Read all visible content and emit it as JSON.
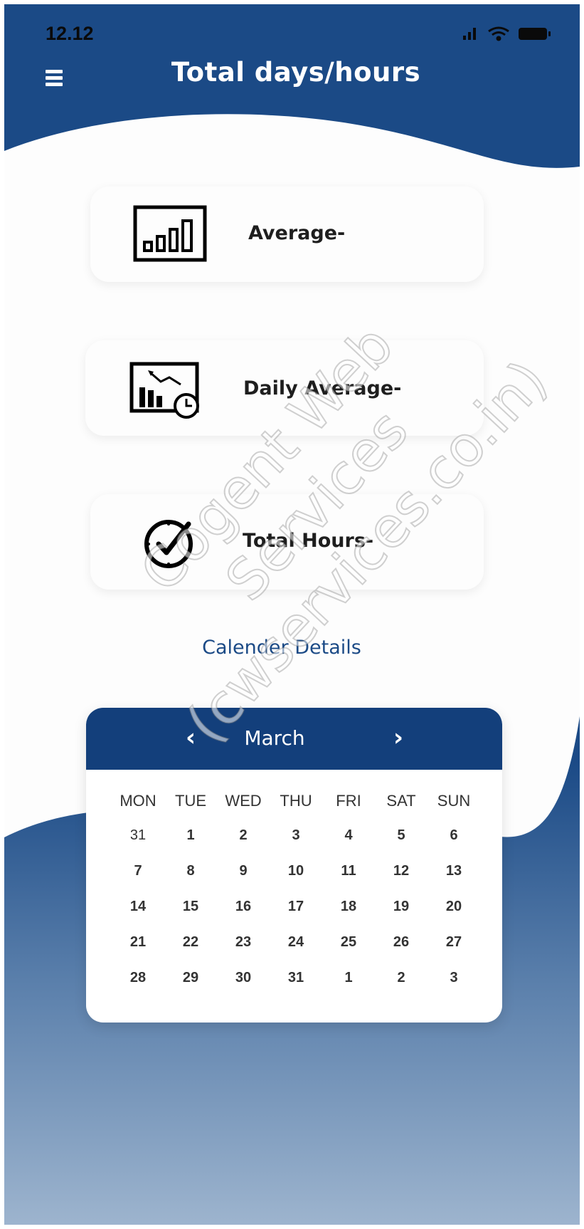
{
  "status_bar": {
    "time": "12.12"
  },
  "header": {
    "title": "Total days/hours"
  },
  "cards": [
    {
      "label": "Average-",
      "icon": "bar-chart-icon"
    },
    {
      "label": "Daily Average-",
      "icon": "chart-clock-icon"
    },
    {
      "label": "Total Hours-",
      "icon": "clock-check-icon"
    }
  ],
  "calendar_link": "Calender Details",
  "calendar": {
    "month": "March",
    "prev": "‹",
    "next": "›",
    "weekdays": [
      "MON",
      "TUE",
      "WED",
      "THU",
      "FRI",
      "SAT",
      "SUN"
    ],
    "weeks": [
      [
        "31",
        "1",
        "2",
        "3",
        "4",
        "5",
        "6"
      ],
      [
        "7",
        "8",
        "9",
        "10",
        "11",
        "12",
        "13"
      ],
      [
        "14",
        "15",
        "16",
        "17",
        "18",
        "19",
        "20"
      ],
      [
        "21",
        "22",
        "23",
        "24",
        "25",
        "26",
        "27"
      ],
      [
        "28",
        "29",
        "30",
        "31",
        "1",
        "2",
        "3"
      ]
    ]
  },
  "watermark": {
    "line1": "Cogent Web Services",
    "line2": "(cwservices.co.in)"
  },
  "colors": {
    "primary": "#1b4a86",
    "calendar_header": "#133f7b",
    "card": "#fdfdfd"
  }
}
